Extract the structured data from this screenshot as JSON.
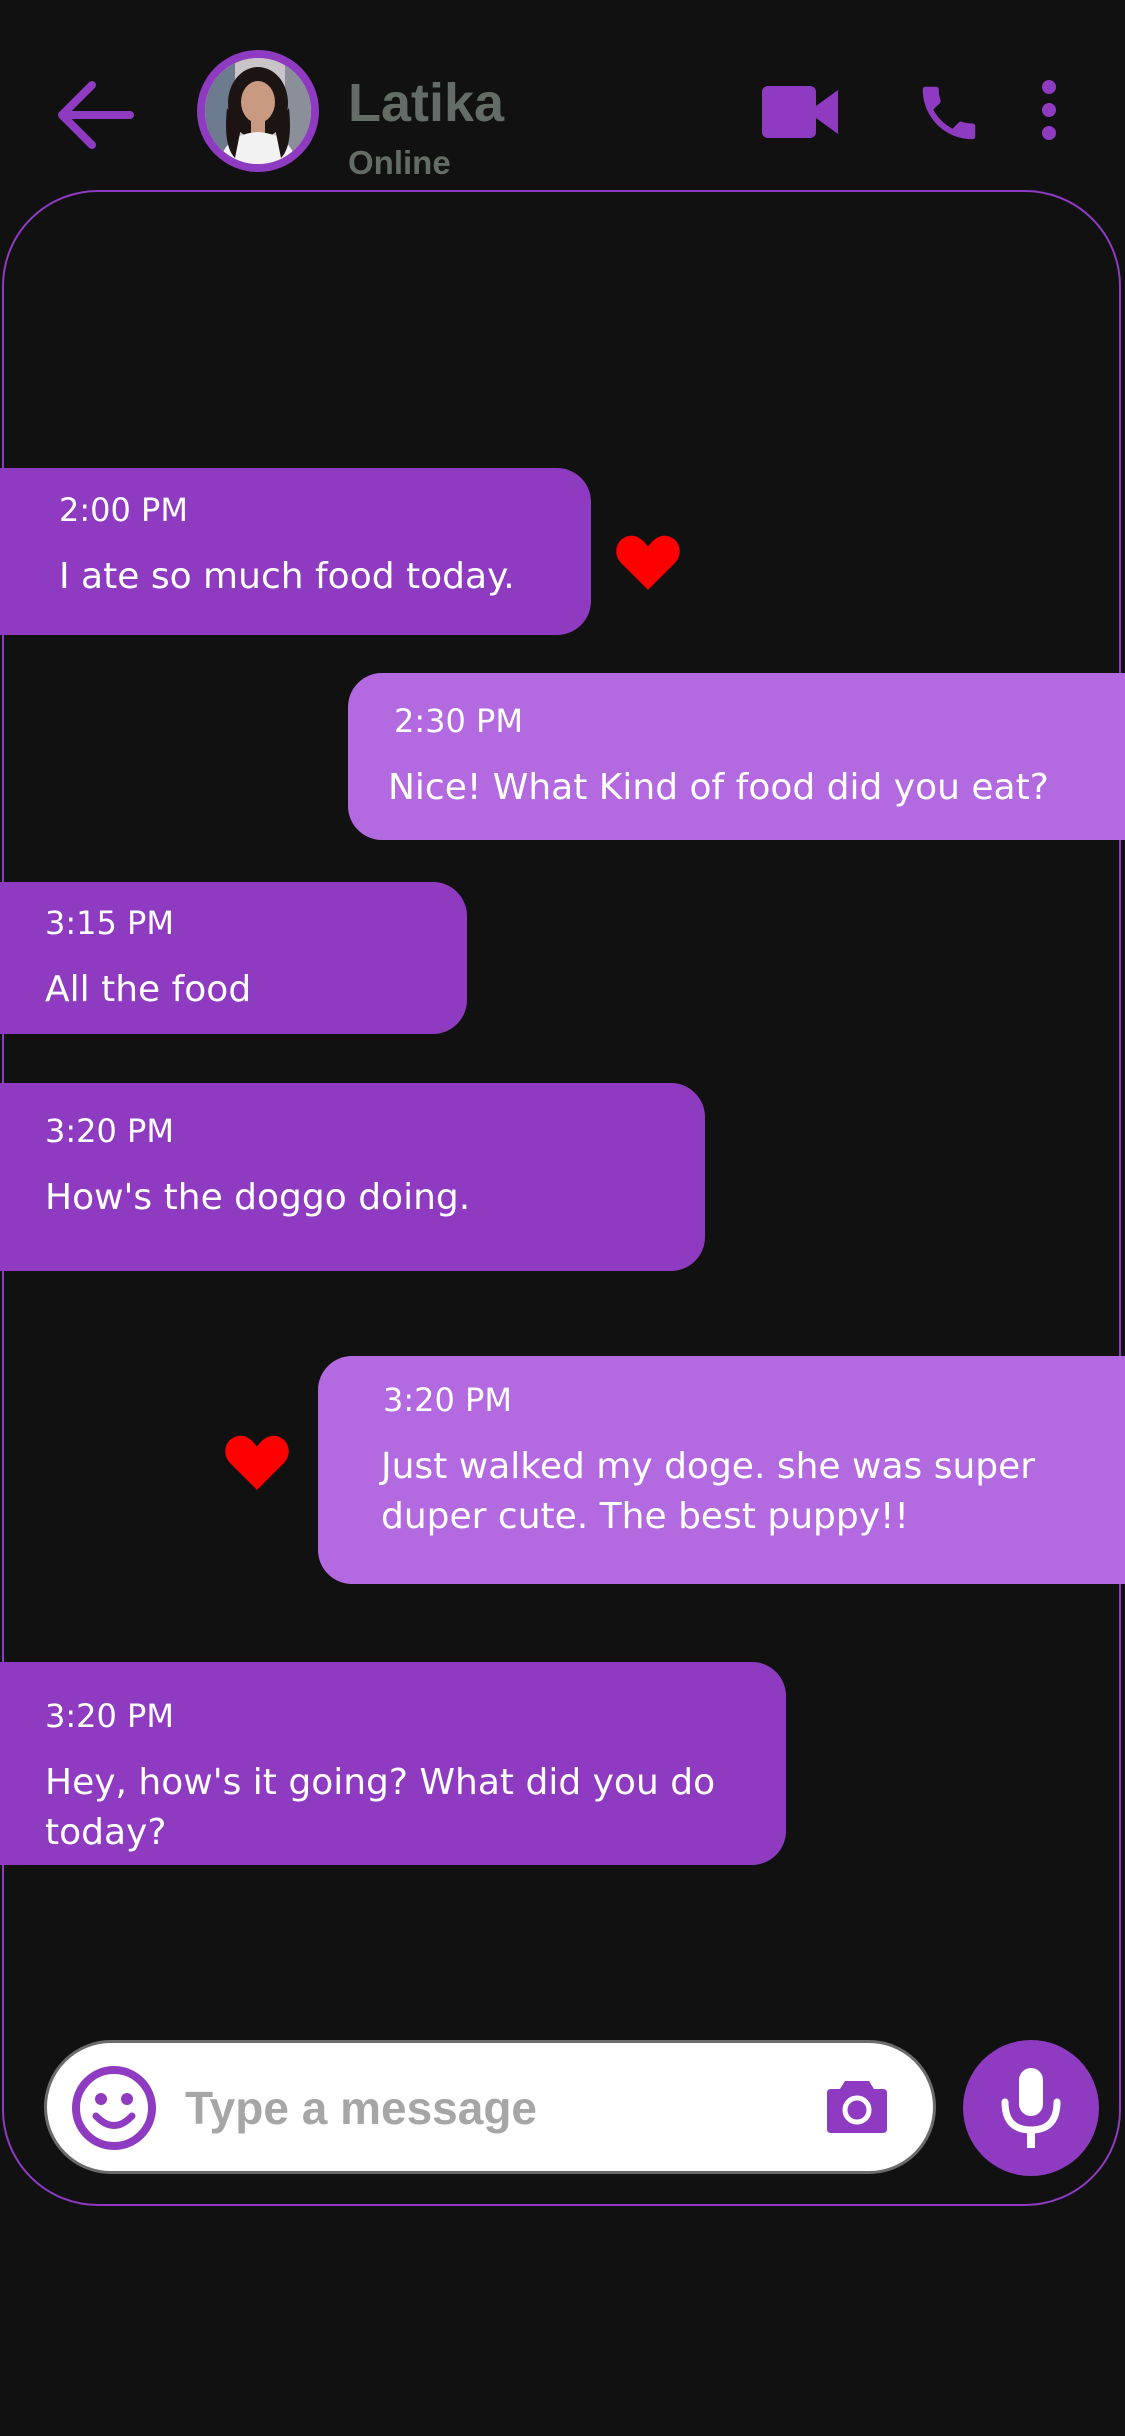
{
  "header": {
    "contact_name": "Latika",
    "status": "Online",
    "back_icon": "arrow-left-icon",
    "video_icon": "video-camera-icon",
    "call_icon": "phone-icon",
    "more_icon": "more-vertical-icon"
  },
  "messages": [
    {
      "direction": "received",
      "time": "2:00 PM",
      "text": "I ate so much food today.",
      "liked": true
    },
    {
      "direction": "sent",
      "time": "2:30 PM",
      "text": "Nice! What Kind of food did you eat?",
      "liked": false
    },
    {
      "direction": "received",
      "time": "3:15 PM",
      "text": "All the food",
      "liked": false
    },
    {
      "direction": "received",
      "time": "3:20 PM",
      "text": "How's the doggo doing.",
      "liked": false
    },
    {
      "direction": "sent",
      "time": "3:20 PM",
      "text": "Just walked my doge. she was super duper cute. The best puppy!!",
      "liked": true
    },
    {
      "direction": "received",
      "time": "3:20 PM",
      "text": "Hey, how's it going? What did you do today?",
      "liked": false
    }
  ],
  "composer": {
    "placeholder": "Type a message",
    "emoji_icon": "smiley-icon",
    "camera_icon": "camera-icon",
    "mic_icon": "microphone-icon"
  },
  "colors": {
    "accent": "#8e3bc1",
    "sent_bubble": "#b36ae0",
    "background": "#111112",
    "heart": "#ff0000",
    "muted_text": "#646c66"
  }
}
